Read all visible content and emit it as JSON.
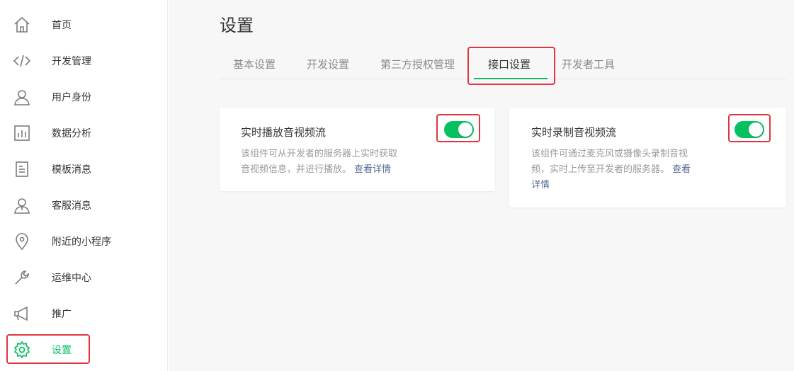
{
  "sidebar": {
    "items": [
      {
        "label": "首页",
        "icon": "home-icon"
      },
      {
        "label": "开发管理",
        "icon": "code-icon"
      },
      {
        "label": "用户身份",
        "icon": "user-icon"
      },
      {
        "label": "数据分析",
        "icon": "chart-icon"
      },
      {
        "label": "模板消息",
        "icon": "document-icon"
      },
      {
        "label": "客服消息",
        "icon": "service-icon"
      },
      {
        "label": "附近的小程序",
        "icon": "location-icon"
      },
      {
        "label": "运维中心",
        "icon": "wrench-icon"
      },
      {
        "label": "推广",
        "icon": "megaphone-icon"
      },
      {
        "label": "设置",
        "icon": "gear-icon",
        "active": true
      }
    ]
  },
  "main": {
    "title": "设置",
    "tabs": [
      {
        "label": "基本设置"
      },
      {
        "label": "开发设置"
      },
      {
        "label": "第三方授权管理"
      },
      {
        "label": "接口设置",
        "active": true
      },
      {
        "label": "开发者工具"
      }
    ],
    "cards": [
      {
        "title": "实时播放音视频流",
        "desc_line1": "该组件可从开发者的服务器上实时获取",
        "desc_line2": "音视频信息，并进行播放。",
        "link": "查看详情",
        "enabled": true
      },
      {
        "title": "实时录制音视频流",
        "desc_line1": "该组件可通过麦克风或摄像头录制音视",
        "desc_line2": "频，实时上传至开发者的服务器。",
        "link_part1": "查看",
        "link_part2": "详情",
        "enabled": true
      }
    ]
  },
  "colors": {
    "accent": "#07c160",
    "highlight": "#e0353f",
    "link": "#576b95"
  }
}
